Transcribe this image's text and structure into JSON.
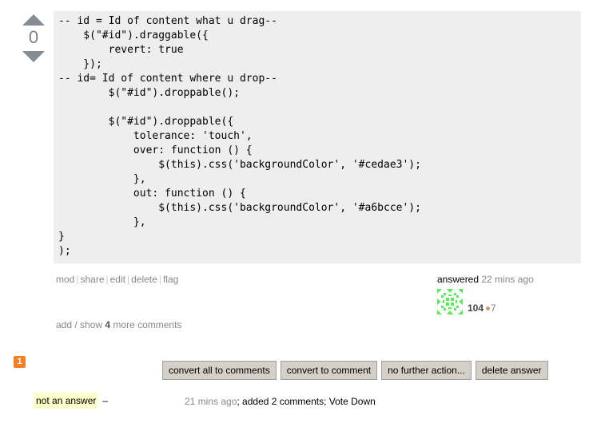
{
  "vote": {
    "up_icon": "vote-up-arrow",
    "count": "0",
    "down_icon": "vote-down-arrow"
  },
  "code_block": {
    "lines": [
      "-- id = Id of content what u drag--",
      "    $(\"#id\").draggable({",
      "        revert: true",
      "    });",
      "-- id= Id of content where u drop--",
      "        $(\"#id\").droppable();",
      "",
      "        $(\"#id\").droppable({",
      "            tolerance: 'touch',",
      "            over: function () {",
      "                $(this).css('backgroundColor', '#cedae3');",
      "            },",
      "            out: function () {",
      "                $(this).css('backgroundColor', '#a6bcce');",
      "            },",
      "}",
      ");"
    ]
  },
  "post_menu": {
    "items": [
      "mod",
      "share",
      "edit",
      "delete",
      "flag"
    ]
  },
  "user_info": {
    "action": "answered",
    "time": "22 mins ago",
    "avatar_icon": "identicon-avatar",
    "reputation": "104",
    "bronze_badges": "7",
    "badge_color": "#cc9966"
  },
  "comments": {
    "prefix": "add / show ",
    "count": "4",
    "suffix": " more comments"
  },
  "moderation": {
    "flag_count": "1",
    "flag_color": "#f48024",
    "buttons": [
      "convert all to comments",
      "convert to comment",
      "no further action...",
      "delete answer"
    ],
    "flag_reason": "not an answer",
    "dash": "–",
    "flag_time": "21 mins ago",
    "flag_detail": "; added 2 comments; Vote Down"
  }
}
